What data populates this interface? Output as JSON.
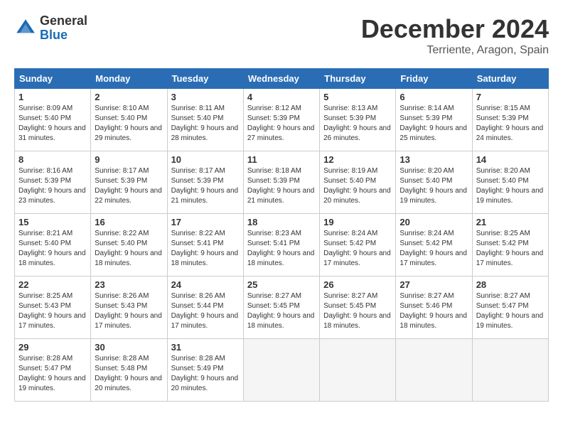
{
  "logo": {
    "general": "General",
    "blue": "Blue"
  },
  "title": "December 2024",
  "location": "Terriente, Aragon, Spain",
  "days_of_week": [
    "Sunday",
    "Monday",
    "Tuesday",
    "Wednesday",
    "Thursday",
    "Friday",
    "Saturday"
  ],
  "weeks": [
    [
      {
        "day": 1,
        "sunrise": "Sunrise: 8:09 AM",
        "sunset": "Sunset: 5:40 PM",
        "daylight": "Daylight: 9 hours and 31 minutes."
      },
      {
        "day": 2,
        "sunrise": "Sunrise: 8:10 AM",
        "sunset": "Sunset: 5:40 PM",
        "daylight": "Daylight: 9 hours and 29 minutes."
      },
      {
        "day": 3,
        "sunrise": "Sunrise: 8:11 AM",
        "sunset": "Sunset: 5:40 PM",
        "daylight": "Daylight: 9 hours and 28 minutes."
      },
      {
        "day": 4,
        "sunrise": "Sunrise: 8:12 AM",
        "sunset": "Sunset: 5:39 PM",
        "daylight": "Daylight: 9 hours and 27 minutes."
      },
      {
        "day": 5,
        "sunrise": "Sunrise: 8:13 AM",
        "sunset": "Sunset: 5:39 PM",
        "daylight": "Daylight: 9 hours and 26 minutes."
      },
      {
        "day": 6,
        "sunrise": "Sunrise: 8:14 AM",
        "sunset": "Sunset: 5:39 PM",
        "daylight": "Daylight: 9 hours and 25 minutes."
      },
      {
        "day": 7,
        "sunrise": "Sunrise: 8:15 AM",
        "sunset": "Sunset: 5:39 PM",
        "daylight": "Daylight: 9 hours and 24 minutes."
      }
    ],
    [
      {
        "day": 8,
        "sunrise": "Sunrise: 8:16 AM",
        "sunset": "Sunset: 5:39 PM",
        "daylight": "Daylight: 9 hours and 23 minutes."
      },
      {
        "day": 9,
        "sunrise": "Sunrise: 8:17 AM",
        "sunset": "Sunset: 5:39 PM",
        "daylight": "Daylight: 9 hours and 22 minutes."
      },
      {
        "day": 10,
        "sunrise": "Sunrise: 8:17 AM",
        "sunset": "Sunset: 5:39 PM",
        "daylight": "Daylight: 9 hours and 21 minutes."
      },
      {
        "day": 11,
        "sunrise": "Sunrise: 8:18 AM",
        "sunset": "Sunset: 5:39 PM",
        "daylight": "Daylight: 9 hours and 21 minutes."
      },
      {
        "day": 12,
        "sunrise": "Sunrise: 8:19 AM",
        "sunset": "Sunset: 5:40 PM",
        "daylight": "Daylight: 9 hours and 20 minutes."
      },
      {
        "day": 13,
        "sunrise": "Sunrise: 8:20 AM",
        "sunset": "Sunset: 5:40 PM",
        "daylight": "Daylight: 9 hours and 19 minutes."
      },
      {
        "day": 14,
        "sunrise": "Sunrise: 8:20 AM",
        "sunset": "Sunset: 5:40 PM",
        "daylight": "Daylight: 9 hours and 19 minutes."
      }
    ],
    [
      {
        "day": 15,
        "sunrise": "Sunrise: 8:21 AM",
        "sunset": "Sunset: 5:40 PM",
        "daylight": "Daylight: 9 hours and 18 minutes."
      },
      {
        "day": 16,
        "sunrise": "Sunrise: 8:22 AM",
        "sunset": "Sunset: 5:40 PM",
        "daylight": "Daylight: 9 hours and 18 minutes."
      },
      {
        "day": 17,
        "sunrise": "Sunrise: 8:22 AM",
        "sunset": "Sunset: 5:41 PM",
        "daylight": "Daylight: 9 hours and 18 minutes."
      },
      {
        "day": 18,
        "sunrise": "Sunrise: 8:23 AM",
        "sunset": "Sunset: 5:41 PM",
        "daylight": "Daylight: 9 hours and 18 minutes."
      },
      {
        "day": 19,
        "sunrise": "Sunrise: 8:24 AM",
        "sunset": "Sunset: 5:42 PM",
        "daylight": "Daylight: 9 hours and 17 minutes."
      },
      {
        "day": 20,
        "sunrise": "Sunrise: 8:24 AM",
        "sunset": "Sunset: 5:42 PM",
        "daylight": "Daylight: 9 hours and 17 minutes."
      },
      {
        "day": 21,
        "sunrise": "Sunrise: 8:25 AM",
        "sunset": "Sunset: 5:42 PM",
        "daylight": "Daylight: 9 hours and 17 minutes."
      }
    ],
    [
      {
        "day": 22,
        "sunrise": "Sunrise: 8:25 AM",
        "sunset": "Sunset: 5:43 PM",
        "daylight": "Daylight: 9 hours and 17 minutes."
      },
      {
        "day": 23,
        "sunrise": "Sunrise: 8:26 AM",
        "sunset": "Sunset: 5:43 PM",
        "daylight": "Daylight: 9 hours and 17 minutes."
      },
      {
        "day": 24,
        "sunrise": "Sunrise: 8:26 AM",
        "sunset": "Sunset: 5:44 PM",
        "daylight": "Daylight: 9 hours and 17 minutes."
      },
      {
        "day": 25,
        "sunrise": "Sunrise: 8:27 AM",
        "sunset": "Sunset: 5:45 PM",
        "daylight": "Daylight: 9 hours and 18 minutes."
      },
      {
        "day": 26,
        "sunrise": "Sunrise: 8:27 AM",
        "sunset": "Sunset: 5:45 PM",
        "daylight": "Daylight: 9 hours and 18 minutes."
      },
      {
        "day": 27,
        "sunrise": "Sunrise: 8:27 AM",
        "sunset": "Sunset: 5:46 PM",
        "daylight": "Daylight: 9 hours and 18 minutes."
      },
      {
        "day": 28,
        "sunrise": "Sunrise: 8:27 AM",
        "sunset": "Sunset: 5:47 PM",
        "daylight": "Daylight: 9 hours and 19 minutes."
      }
    ],
    [
      {
        "day": 29,
        "sunrise": "Sunrise: 8:28 AM",
        "sunset": "Sunset: 5:47 PM",
        "daylight": "Daylight: 9 hours and 19 minutes."
      },
      {
        "day": 30,
        "sunrise": "Sunrise: 8:28 AM",
        "sunset": "Sunset: 5:48 PM",
        "daylight": "Daylight: 9 hours and 20 minutes."
      },
      {
        "day": 31,
        "sunrise": "Sunrise: 8:28 AM",
        "sunset": "Sunset: 5:49 PM",
        "daylight": "Daylight: 9 hours and 20 minutes."
      },
      null,
      null,
      null,
      null
    ]
  ]
}
